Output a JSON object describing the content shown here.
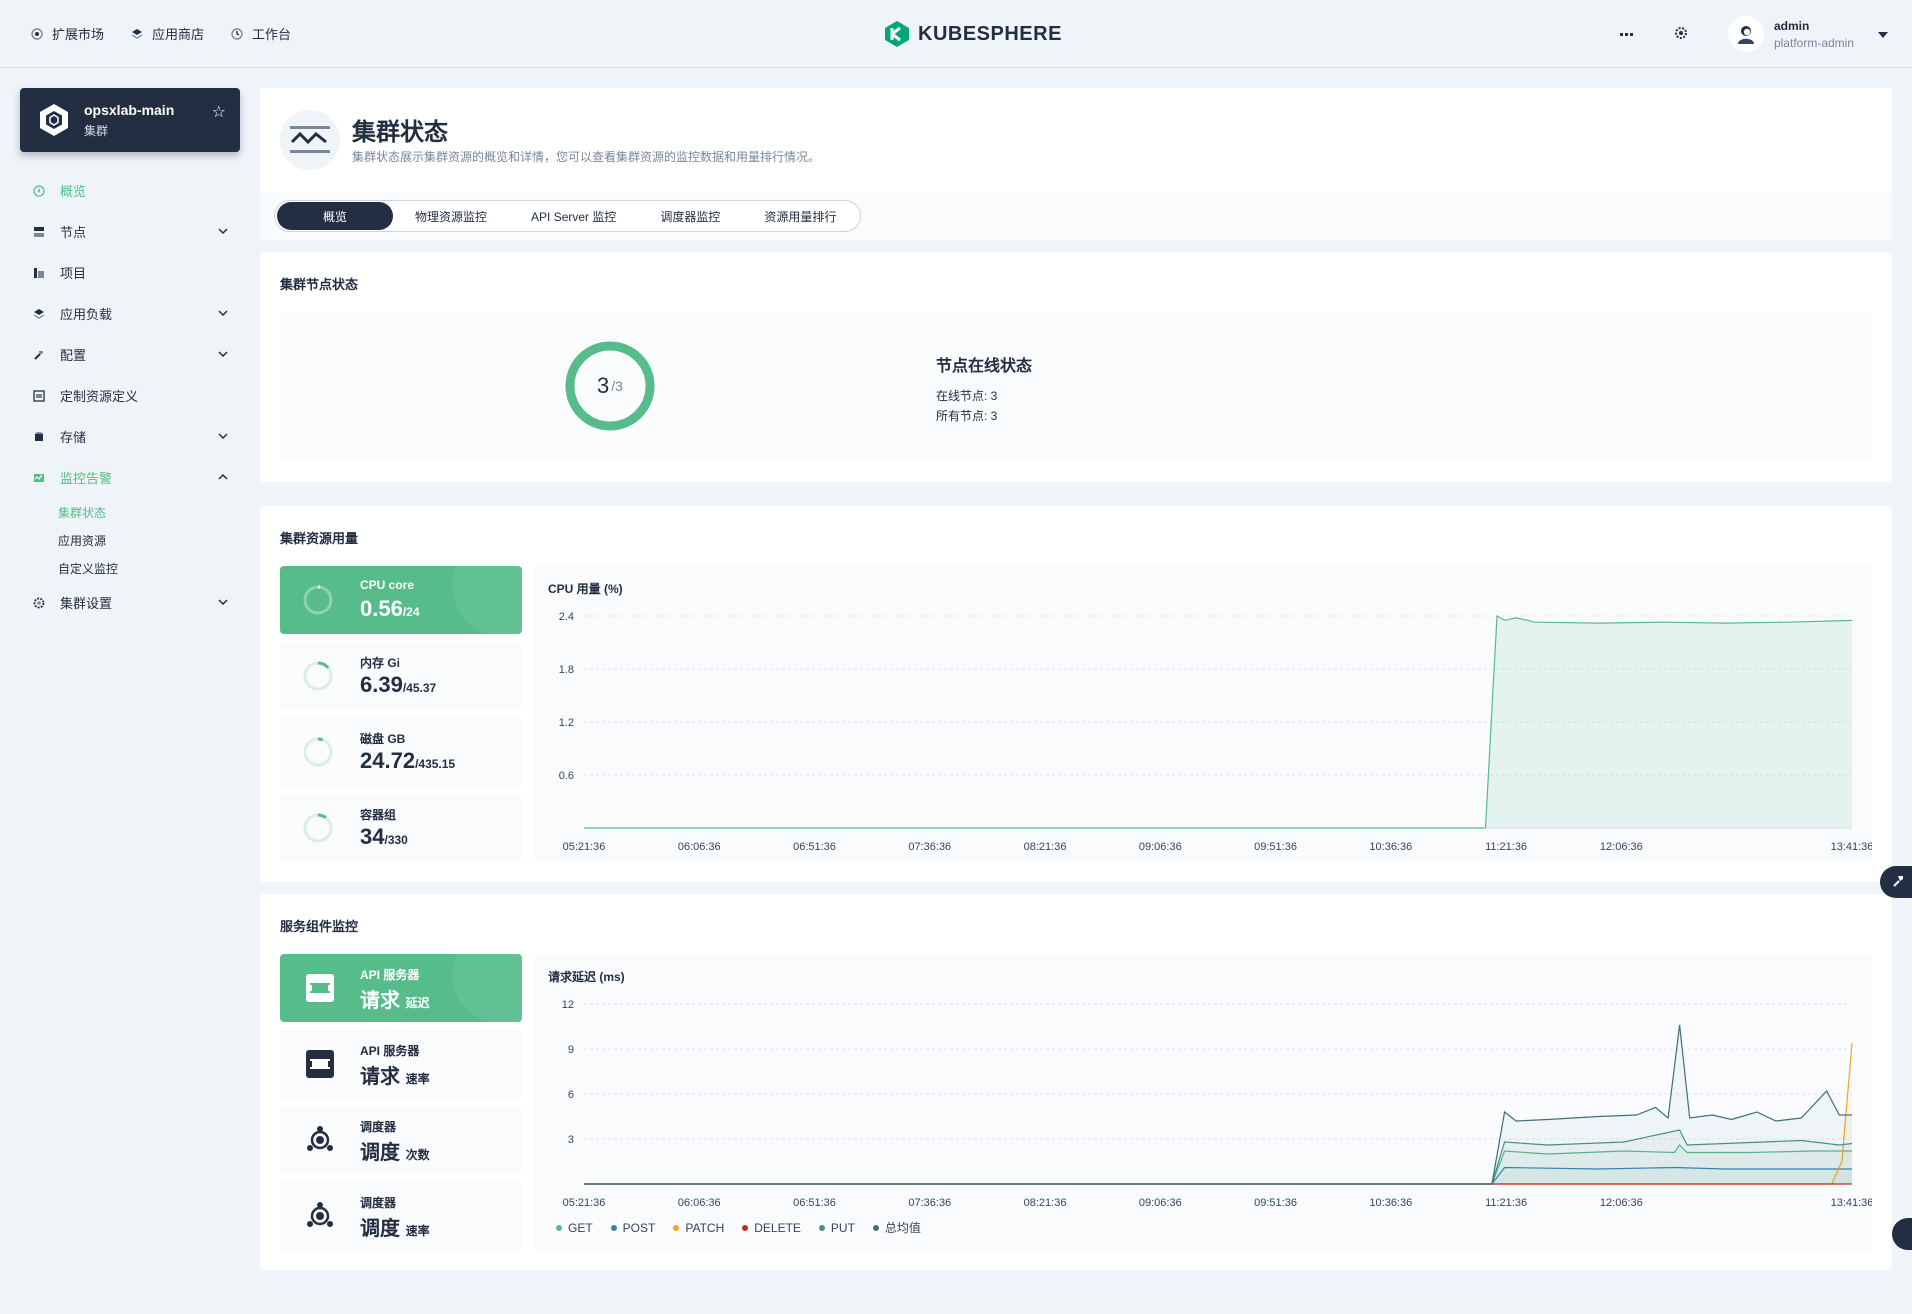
{
  "topnav": [
    {
      "label": "扩展市场",
      "icon": "extension-icon"
    },
    {
      "label": "应用商店",
      "icon": "app-store-icon"
    },
    {
      "label": "工作台",
      "icon": "dashboard-icon"
    }
  ],
  "brand": {
    "name": "KUBESPHERE"
  },
  "user": {
    "name": "admin",
    "role": "platform-admin"
  },
  "cluster": {
    "name": "opsxlab-main",
    "type": "集群"
  },
  "sidebar": {
    "items": [
      {
        "label": "概览",
        "icon": "overview-icon",
        "expandable": false,
        "active": true
      },
      {
        "label": "节点",
        "icon": "nodes-icon",
        "expandable": true
      },
      {
        "label": "项目",
        "icon": "project-icon",
        "expandable": false
      },
      {
        "label": "应用负载",
        "icon": "workload-icon",
        "expandable": true
      },
      {
        "label": "配置",
        "icon": "config-icon",
        "expandable": true
      },
      {
        "label": "定制资源定义",
        "icon": "crd-icon",
        "expandable": false
      },
      {
        "label": "存储",
        "icon": "storage-icon",
        "expandable": true
      },
      {
        "label": "监控告警",
        "icon": "monitoring-icon",
        "expandable": true,
        "expanded": true
      },
      {
        "label": "集群设置",
        "icon": "settings-icon",
        "expandable": true
      }
    ],
    "monitoring_sub": [
      "集群状态",
      "应用资源",
      "自定义监控"
    ]
  },
  "page": {
    "title": "集群状态",
    "description": "集群状态展示集群资源的概览和详情，您可以查看集群资源的监控数据和用量排行情况。"
  },
  "tabs": [
    "概览",
    "物理资源监控",
    "API Server 监控",
    "调度器监控",
    "资源用量排行"
  ],
  "node_status": {
    "title": "集群节点状态",
    "online": "3",
    "total": "/3",
    "info_title": "节点在线状态",
    "online_line": "在线节点: 3",
    "total_line": "所有节点: 3",
    "online_fraction": 1.0
  },
  "resource_usage": {
    "title": "集群资源用量",
    "metrics": [
      {
        "label": "CPU core",
        "value": "0.56",
        "total": "/24",
        "fraction": 0.023
      },
      {
        "label": "内存 Gi",
        "value": "6.39",
        "total": "/45.37",
        "fraction": 0.14
      },
      {
        "label": "磁盘 GB",
        "value": "24.72",
        "total": "/435.15",
        "fraction": 0.057
      },
      {
        "label": "容器组",
        "value": "34",
        "total": "/330",
        "fraction": 0.103
      }
    ]
  },
  "service_monitor": {
    "title": "服务组件监控",
    "items": [
      {
        "label": "API 服务器",
        "value": "请求",
        "unit": "延迟",
        "icon": "api-server-icon"
      },
      {
        "label": "API 服务器",
        "value": "请求",
        "unit": "速率",
        "icon": "api-server-icon"
      },
      {
        "label": "调度器",
        "value": "调度",
        "unit": "次数",
        "icon": "scheduler-icon"
      },
      {
        "label": "调度器",
        "value": "调度",
        "unit": "速率",
        "icon": "scheduler-icon"
      }
    ]
  },
  "colors": {
    "accent": "#55bc8a",
    "dark": "#242e42",
    "get": "#55bc8a",
    "post": "#3385b0",
    "patch": "#f5a623",
    "delete": "#ca2621",
    "put": "#4a8f84",
    "total": "#3f7079"
  },
  "chart_data": [
    {
      "type": "area",
      "title": "CPU 用量 (%)",
      "x": [
        "05:21:36",
        "06:06:36",
        "06:51:36",
        "07:36:36",
        "08:21:36",
        "09:06:36",
        "09:51:36",
        "10:36:36",
        "11:21:36",
        "12:06:36",
        "13:41:36"
      ],
      "ylim": [
        0,
        2.4
      ],
      "yticks": [
        0.6,
        1.2,
        1.8,
        2.4
      ],
      "series": [
        {
          "name": "CPU",
          "points": [
            [
              0,
              0
            ],
            [
              0.711,
              0
            ],
            [
              0.72,
              2.4
            ],
            [
              0.726,
              2.35
            ],
            [
              0.735,
              2.38
            ],
            [
              0.75,
              2.33
            ],
            [
              0.8,
              2.32
            ],
            [
              0.85,
              2.33
            ],
            [
              0.9,
              2.32
            ],
            [
              0.95,
              2.33
            ],
            [
              1.0,
              2.35
            ]
          ]
        }
      ]
    },
    {
      "type": "line",
      "title": "请求延迟 (ms)",
      "x": [
        "05:21:36",
        "06:06:36",
        "06:51:36",
        "07:36:36",
        "08:21:36",
        "09:06:36",
        "09:51:36",
        "10:36:36",
        "11:21:36",
        "12:06:36",
        "13:41:36"
      ],
      "ylim": [
        0,
        12
      ],
      "yticks": [
        3,
        6,
        9,
        12
      ],
      "series": [
        {
          "name": "GET",
          "points": [
            [
              0,
              0
            ],
            [
              0.716,
              0
            ],
            [
              0.726,
              2.2
            ],
            [
              0.76,
              2.0
            ],
            [
              0.82,
              2.2
            ],
            [
              0.86,
              2.1
            ],
            [
              0.864,
              2.6
            ],
            [
              0.87,
              2.1
            ],
            [
              0.92,
              2.1
            ],
            [
              0.97,
              2.2
            ],
            [
              1.0,
              2.2
            ]
          ]
        },
        {
          "name": "POST",
          "points": [
            [
              0,
              0
            ],
            [
              0.716,
              0
            ],
            [
              0.726,
              1.1
            ],
            [
              0.8,
              1.0
            ],
            [
              0.86,
              1.1
            ],
            [
              0.9,
              1.0
            ],
            [
              1.0,
              1.0
            ]
          ]
        },
        {
          "name": "PATCH",
          "points": [
            [
              0,
              0
            ],
            [
              0.984,
              0
            ],
            [
              0.992,
              1.5
            ],
            [
              1.0,
              9.4
            ]
          ]
        },
        {
          "name": "DELETE",
          "points": [
            [
              0,
              0
            ],
            [
              1.0,
              0
            ]
          ]
        },
        {
          "name": "PUT",
          "points": [
            [
              0,
              0
            ],
            [
              0.716,
              0
            ],
            [
              0.726,
              2.8
            ],
            [
              0.76,
              2.6
            ],
            [
              0.82,
              2.8
            ],
            [
              0.864,
              3.6
            ],
            [
              0.87,
              2.6
            ],
            [
              0.96,
              2.9
            ],
            [
              0.99,
              2.6
            ],
            [
              1.0,
              2.7
            ]
          ]
        },
        {
          "name": "总均值",
          "points": [
            [
              0,
              0
            ],
            [
              0.716,
              0
            ],
            [
              0.726,
              4.8
            ],
            [
              0.735,
              4.2
            ],
            [
              0.76,
              4.3
            ],
            [
              0.8,
              4.5
            ],
            [
              0.83,
              4.6
            ],
            [
              0.845,
              5.1
            ],
            [
              0.855,
              4.4
            ],
            [
              0.864,
              10.6
            ],
            [
              0.872,
              4.4
            ],
            [
              0.89,
              4.6
            ],
            [
              0.905,
              4.3
            ],
            [
              0.925,
              4.8
            ],
            [
              0.94,
              4.2
            ],
            [
              0.96,
              4.4
            ],
            [
              0.98,
              6.2
            ],
            [
              0.99,
              4.6
            ],
            [
              1.0,
              4.6
            ]
          ]
        }
      ]
    }
  ]
}
